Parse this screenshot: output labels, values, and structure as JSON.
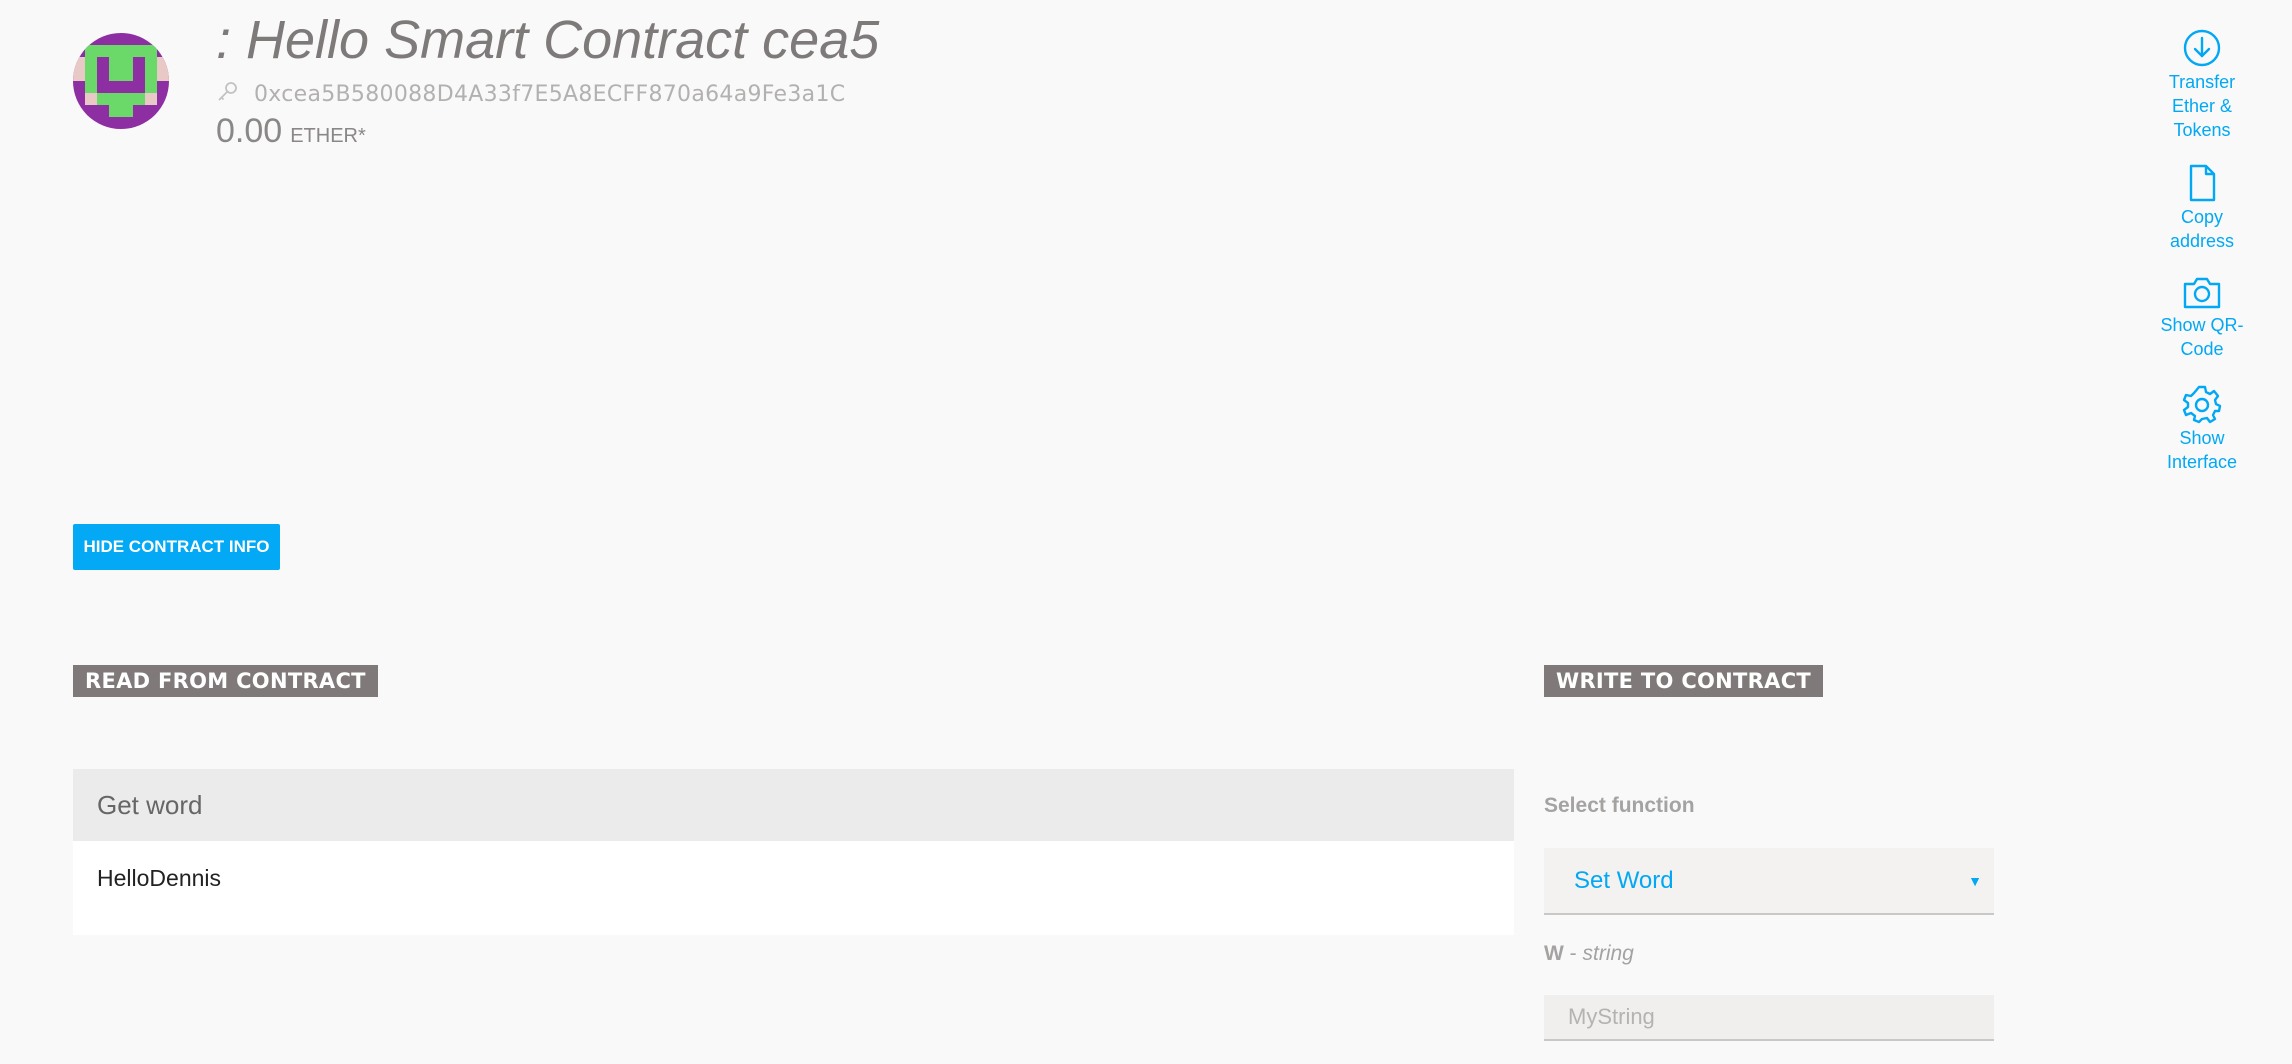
{
  "header": {
    "title": ": Hello Smart Contract cea5",
    "address": "0xcea5B580088D4A33f7E5A8ECFF870a64a9Fe3a1C",
    "balance": "0.00",
    "unit": "ETHER*"
  },
  "actions": [
    {
      "label": "Transfer Ether & Tokens",
      "icon": "download-circle-icon"
    },
    {
      "label": "Copy address",
      "icon": "document-icon"
    },
    {
      "label": "Show QR-Code",
      "icon": "camera-icon"
    },
    {
      "label": "Show Interface",
      "icon": "gear-icon"
    }
  ],
  "hide_button": "HIDE CONTRACT INFO",
  "read": {
    "heading": "READ FROM CONTRACT",
    "function_name": "Get word",
    "result": "HelloDennis"
  },
  "write": {
    "heading": "WRITE TO CONTRACT",
    "select_label": "Select function",
    "selected_function": "Set Word",
    "param_name": "W",
    "param_type": "string",
    "param_placeholder": "MyString"
  },
  "colors": {
    "accent": "#03a9f4",
    "section_header_bg": "#7f7a79",
    "title_gray": "#7d7a79"
  }
}
